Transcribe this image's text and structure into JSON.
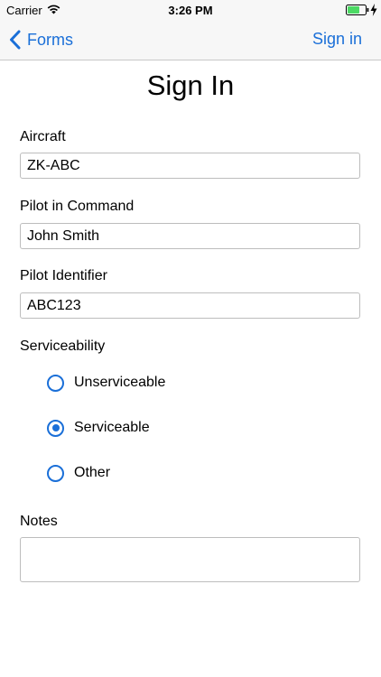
{
  "status_bar": {
    "carrier": "Carrier",
    "time": "3:26 PM",
    "battery_color": "#4cd964",
    "icons": [
      "wifi-icon",
      "battery-icon",
      "charging-icon"
    ]
  },
  "nav": {
    "back_label": "Forms",
    "action_label": "Sign in",
    "accent_color": "#1a6fd8"
  },
  "form": {
    "title": "Sign In",
    "aircraft": {
      "label": "Aircraft",
      "value": "ZK-ABC"
    },
    "pilot": {
      "label": "Pilot in Command",
      "value": "John Smith"
    },
    "pilot_id": {
      "label": "Pilot Identifier",
      "value": "ABC123"
    },
    "serviceability": {
      "label": "Serviceability",
      "options": [
        "Unserviceable",
        "Serviceable",
        "Other"
      ],
      "selected": "Serviceable"
    },
    "notes": {
      "label": "Notes",
      "value": ""
    }
  }
}
